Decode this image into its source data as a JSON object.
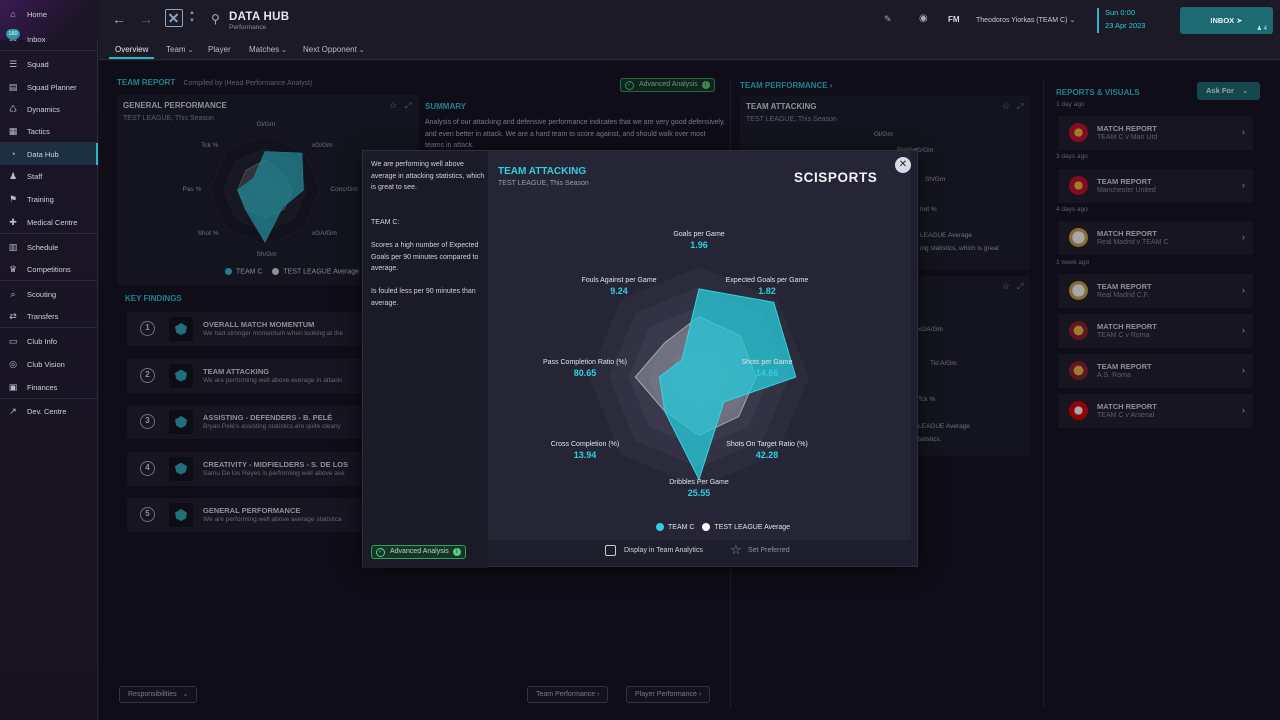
{
  "sidebar": {
    "inbox_badge": "160",
    "items": [
      {
        "label": "Home",
        "icon": "home-icon"
      },
      {
        "label": "Inbox",
        "icon": "inbox-icon"
      },
      {
        "label": "Squad",
        "icon": "squad-icon"
      },
      {
        "label": "Squad Planner",
        "icon": "squad-planner-icon"
      },
      {
        "label": "Dynamics",
        "icon": "dynamics-icon"
      },
      {
        "label": "Tactics",
        "icon": "tactics-icon"
      },
      {
        "label": "Data Hub",
        "icon": "data-hub-icon"
      },
      {
        "label": "Staff",
        "icon": "staff-icon"
      },
      {
        "label": "Training",
        "icon": "training-icon"
      },
      {
        "label": "Medical Centre",
        "icon": "medical-icon"
      },
      {
        "label": "Schedule",
        "icon": "schedule-icon"
      },
      {
        "label": "Competitions",
        "icon": "trophy-icon"
      },
      {
        "label": "Scouting",
        "icon": "scouting-icon"
      },
      {
        "label": "Transfers",
        "icon": "transfers-icon"
      },
      {
        "label": "Club Info",
        "icon": "club-info-icon"
      },
      {
        "label": "Club Vision",
        "icon": "club-vision-icon"
      },
      {
        "label": "Finances",
        "icon": "finances-icon"
      },
      {
        "label": "Dev. Centre",
        "icon": "dev-centre-icon"
      }
    ],
    "active": "Data Hub"
  },
  "topbar": {
    "title": "DATA HUB",
    "subtitle": "Performance",
    "tabs": [
      "Overview",
      "Team",
      "Player",
      "Matches",
      "Next Opponent"
    ],
    "fm_logo": "FM",
    "manager": "Theodoros Yiorkas (TEAM C)",
    "day_time": "Sun 0:00",
    "date": "23 Apr 2023",
    "inbox_label": "INBOX",
    "inbox_count": "4"
  },
  "team_report": {
    "header": "TEAM REPORT",
    "compiled_by": "Compiled by (Head Performance Analyst)",
    "advanced_label": "Advanced Analysis",
    "general": {
      "title": "GENERAL PERFORMANCE",
      "subtitle": "TEST LEAGUE, This Season",
      "axes": [
        "Gl/Gm",
        "xG/Gm",
        "Conc/Gm",
        "xGA/Gm",
        "Sh/Gm",
        "Shot %",
        "Pas %",
        "Tck %"
      ],
      "legend": [
        "TEAM C",
        "TEST LEAGUE Average"
      ]
    },
    "summary": {
      "header": "SUMMARY",
      "text": "Analysis of our attacking and defensive performance indicates that we are very good defensively, and even better in attack. We are a hard team to score against, and should walk over most teams in attack."
    }
  },
  "key_findings": {
    "header": "KEY FINDINGS",
    "items": [
      {
        "num": "1",
        "title": "OVERALL MATCH MOMENTUM",
        "text": "We had stronger momentum when looking at the"
      },
      {
        "num": "2",
        "title": "TEAM ATTACKING",
        "text": "We are performing well above average in attacki"
      },
      {
        "num": "3",
        "title": "ASSISTING - DEFENDERS - B. PELÉ",
        "text": "Bryan Pelé's assisting statistics are quite clearly"
      },
      {
        "num": "4",
        "title": "CREATIVITY - MIDFIELDERS - S. DE LOS",
        "text": "Samu De los Reyes is performing well above ave"
      },
      {
        "num": "5",
        "title": "GENERAL PERFORMANCE",
        "text": "We are performing well above average statistica"
      }
    ]
  },
  "team_performance": {
    "header": "TEAM PERFORMANCE",
    "attacking": {
      "title": "TEAM ATTACKING",
      "subtitle": "TEST LEAGUE, This Season",
      "visible_axes": [
        "Gl/Gm",
        "xG/Gm",
        "Sh/Gm",
        "Fld/Gm",
        "hot %"
      ],
      "legend_fragment": "LEAGUE Average",
      "text_fragment": "ing statistics, which is great"
    },
    "defending": {
      "visible_axes": [
        "xGA/Gm",
        "Tkl A/Gm",
        "Tck %"
      ],
      "legend_fragment": "LEAGUE Average",
      "text_fragment": "tatistics."
    }
  },
  "reports": {
    "header": "REPORTS & VISUALS",
    "ask_for": "Ask For",
    "groups": [
      {
        "ago": "1 day ago",
        "items": [
          {
            "title": "MATCH REPORT",
            "sub": "TEAM C v Man Utd",
            "logo": "man-utd-logo"
          }
        ]
      },
      {
        "ago": "3 days ago",
        "items": [
          {
            "title": "TEAM REPORT",
            "sub": "Manchester United",
            "logo": "man-utd-logo"
          }
        ]
      },
      {
        "ago": "4 days ago",
        "items": [
          {
            "title": "MATCH REPORT",
            "sub": "Real Madrid v TEAM C",
            "logo": "real-madrid-logo"
          }
        ]
      },
      {
        "ago": "1 week ago",
        "items": [
          {
            "title": "TEAM REPORT",
            "sub": "Real Madrid C.F.",
            "logo": "real-madrid-logo"
          },
          {
            "title": "MATCH REPORT",
            "sub": "TEAM C v Roma",
            "logo": "roma-logo"
          },
          {
            "title": "TEAM REPORT",
            "sub": "A.S. Roma",
            "logo": "roma-logo"
          },
          {
            "title": "MATCH REPORT",
            "sub": "TEAM C v Arsenal",
            "logo": "arsenal-logo"
          }
        ]
      }
    ]
  },
  "footer": {
    "responsibilities": "Responsibilities",
    "team_perf_btn": "Team Performance",
    "player_perf_btn": "Player Performance"
  },
  "modal": {
    "left_paragraphs": [
      "We are performing well above average in attacking statistics, which is great to see.",
      "TEAM C:",
      "Scores a high number of Expected Goals per 90 minutes compared to average.",
      "Is fouled less per 90 minutes than average."
    ],
    "advanced_label": "Advanced Analysis",
    "title": "TEAM ATTACKING",
    "subtitle": "TEST LEAGUE, This Season",
    "brand": "SCISPORTS",
    "display_in_team_analytics": "Display in Team Analytics",
    "set_preferred": "Set Preferred"
  },
  "colors": {
    "accent": "#2fd0dc",
    "team": "#2fc3d4",
    "average": "#ffffff",
    "advanced": "#2ea35a"
  },
  "chart_data": {
    "type": "radar",
    "title": "TEAM ATTACKING",
    "subtitle": "TEST LEAGUE, This Season",
    "axes": [
      {
        "label": "Goals per Game",
        "value": "1.96",
        "team": 0.8,
        "avg": 0.55
      },
      {
        "label": "Expected Goals per Game",
        "value": "1.82",
        "team": 0.96,
        "avg": 0.53
      },
      {
        "label": "Shots per Game",
        "value": "14.66",
        "team": 0.88,
        "avg": 0.52
      },
      {
        "label": "Shots On Target Ratio (%)",
        "value": "42.28",
        "team": 0.32,
        "avg": 0.51
      },
      {
        "label": "Dribbles Per Game",
        "value": "25.55",
        "team": 0.93,
        "avg": 0.53
      },
      {
        "label": "Cross Completion (%)",
        "value": "13.94",
        "team": 0.44,
        "avg": 0.44
      },
      {
        "label": "Pass Completion Ratio (%)",
        "value": "80.65",
        "team": 0.36,
        "avg": 0.58
      },
      {
        "label": "Fouls Against per Game",
        "value": "9.24",
        "team": 0.22,
        "avg": 0.44
      }
    ],
    "series": [
      {
        "name": "TEAM C",
        "color": "#2fc3d4"
      },
      {
        "name": "TEST LEAGUE Average",
        "color": "#ffffff"
      }
    ]
  }
}
